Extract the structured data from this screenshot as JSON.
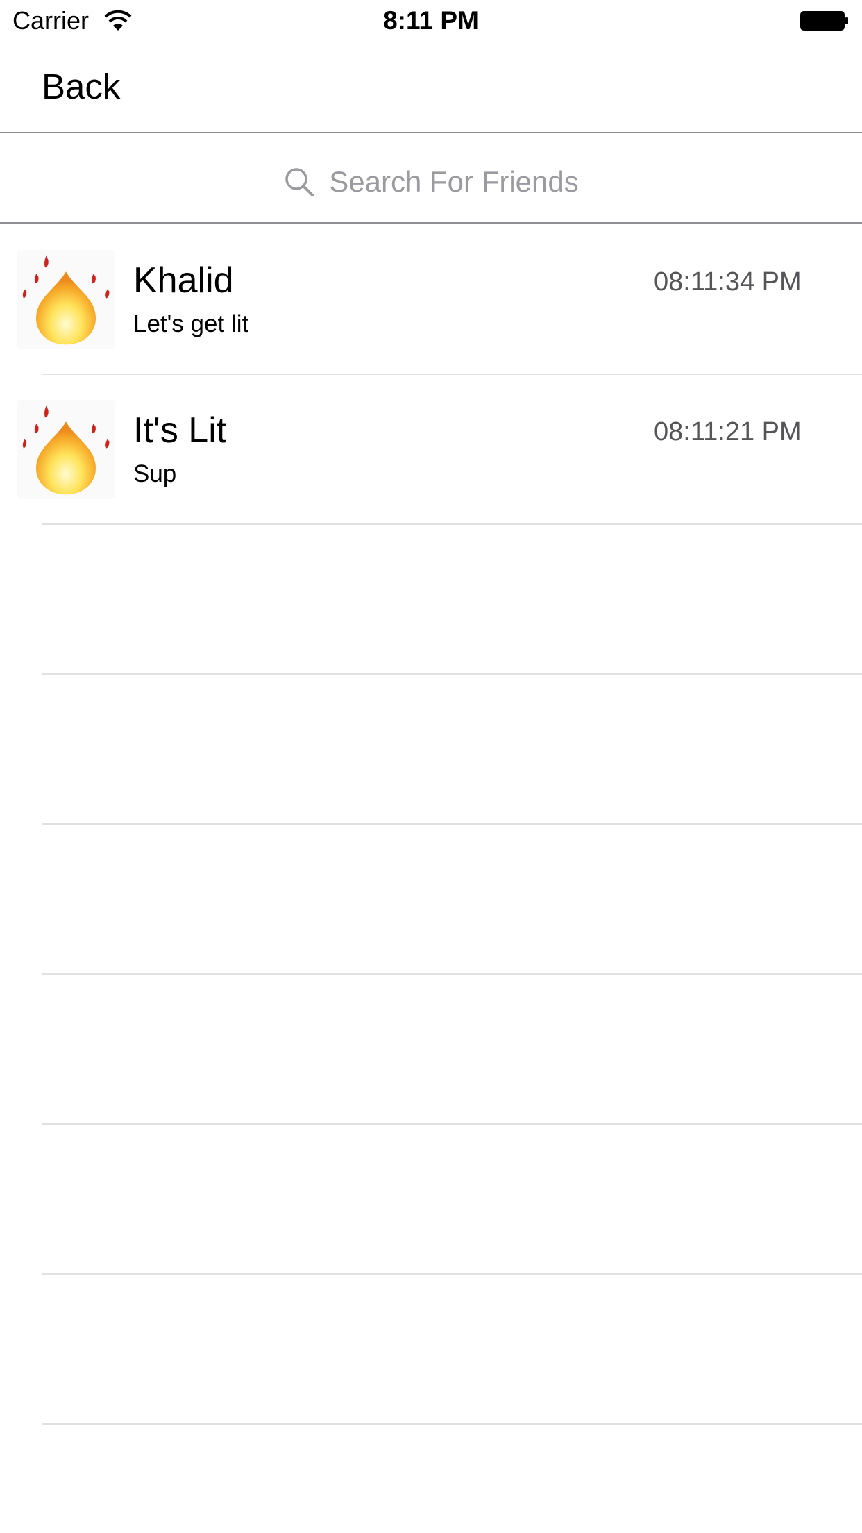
{
  "status_bar": {
    "carrier": "Carrier",
    "time": "8:11 PM"
  },
  "nav": {
    "back_label": "Back"
  },
  "search": {
    "placeholder": "Search For Friends"
  },
  "conversations": [
    {
      "name": "Khalid",
      "message": "Let's get lit",
      "time": "08:11:34 PM",
      "avatar_icon": "fire-icon"
    },
    {
      "name": "It's Lit",
      "message": "Sup",
      "time": "08:11:21 PM",
      "avatar_icon": "fire-icon"
    }
  ],
  "colors": {
    "separator": "#e1e1e4",
    "nav_border": "#8e8e93",
    "placeholder": "#9b9b9f",
    "time_text": "#555558",
    "flame_outer": "#f3a02a",
    "flame_inner": "#ffec70",
    "drop": "#d0211a"
  }
}
